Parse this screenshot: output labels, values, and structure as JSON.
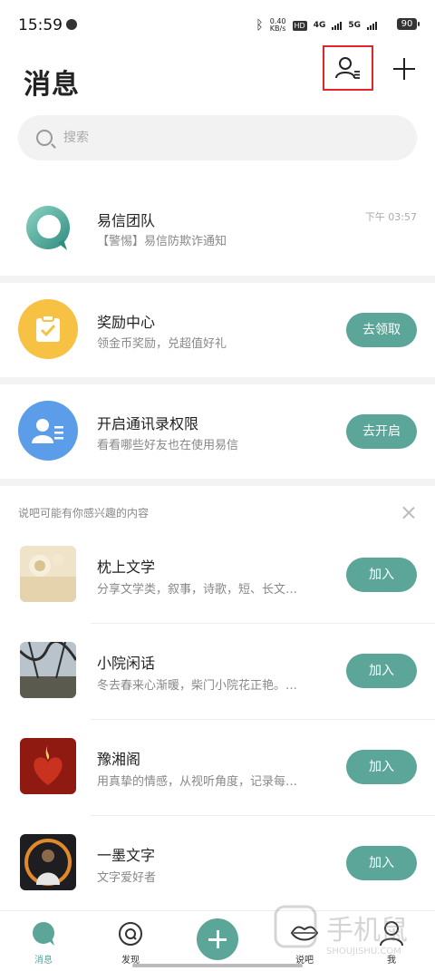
{
  "status_bar": {
    "time": "15:59",
    "speed_value": "0.40",
    "speed_unit": "KB/s",
    "hd_badge": "HD",
    "net1": "4G",
    "net2": "5G",
    "battery": "90"
  },
  "header": {
    "title": "消息"
  },
  "search": {
    "placeholder": "搜索"
  },
  "messages": [
    {
      "title": "易信团队",
      "subtitle": "【警惕】易信防欺诈通知",
      "time": "下午 03:57"
    }
  ],
  "cards": [
    {
      "title": "奖励中心",
      "subtitle": "领金币奖励，兑超值好礼",
      "button": "去领取",
      "color": "#f7c244"
    },
    {
      "title": "开启通讯录权限",
      "subtitle": "看看哪些好友也在使用易信",
      "button": "去开启",
      "color": "#5b9de8"
    }
  ],
  "recommend": {
    "heading": "说吧可能有你感兴趣的内容",
    "items": [
      {
        "title": "枕上文学",
        "subtitle": "分享文学类，叙事，诗歌，短、长文…",
        "button": "加入"
      },
      {
        "title": "小院闲话",
        "subtitle": "冬去春来心渐暖，柴门小院花正艳。…",
        "button": "加入"
      },
      {
        "title": "豫湘阁",
        "subtitle": "用真挚的情感，从视听角度，记录每…",
        "button": "加入"
      },
      {
        "title": "一墨文字",
        "subtitle": "文字爱好者",
        "button": "加入"
      }
    ]
  },
  "bottom_nav": {
    "items": [
      {
        "label": "消息"
      },
      {
        "label": "发现"
      },
      {
        "label": "说吧"
      },
      {
        "label": "我"
      }
    ]
  },
  "colors": {
    "accent": "#5ba599",
    "highlight_box": "#e0252b"
  },
  "icons": {
    "contacts": "contacts-list-icon",
    "add": "plus-icon",
    "search": "search-icon",
    "close": "close-icon"
  },
  "watermark": "SHOUJISHU.COM"
}
